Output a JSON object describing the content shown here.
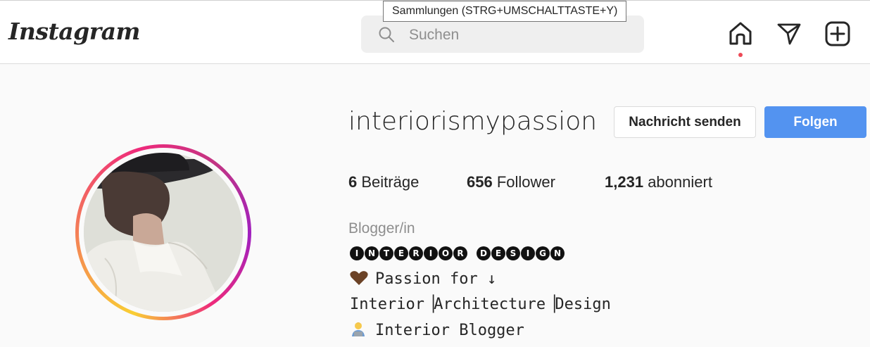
{
  "header": {
    "logo": "Instagram",
    "search": {
      "placeholder": "Suchen",
      "value": ""
    },
    "tooltip": "Sammlungen (STRG+UMSCHALTTASTE+Y)",
    "icons": [
      "home-icon",
      "direct-send-icon",
      "new-post-icon"
    ],
    "notification_color": "#ed4956"
  },
  "profile": {
    "username": "interiorismypassion",
    "message_button": "Nachricht senden",
    "follow_button": "Folgen",
    "stats": {
      "posts_count": "6",
      "posts_label": "Beiträge",
      "followers_count": "656",
      "followers_label": "Follower",
      "following_count": "1,231",
      "following_label": "abonniert"
    },
    "category": "Blogger/in",
    "bio": {
      "title_word1": [
        "I",
        "N",
        "T",
        "E",
        "R",
        "I",
        "O",
        "R"
      ],
      "title_word2": [
        "D",
        "E",
        "S",
        "I",
        "G",
        "N"
      ],
      "line2": "Passion for ↓",
      "line3": "Interior▕Architecture▕Design",
      "line4": "Interior Blogger"
    }
  },
  "colors": {
    "follow_button": "#5393f0",
    "ring_gradient": [
      "#f9ce34",
      "#ee2a7b",
      "#a020c0"
    ]
  }
}
